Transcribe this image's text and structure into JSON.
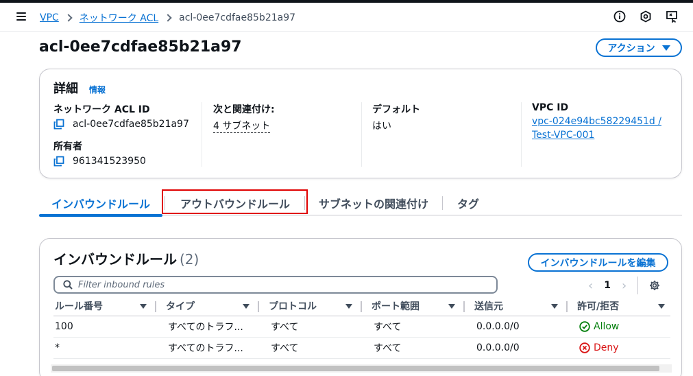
{
  "breadcrumb": {
    "root": "VPC",
    "parent": "ネットワーク ACL",
    "current": "acl-0ee7cdfae85b21a97"
  },
  "page": {
    "title": "acl-0ee7cdfae85b21a97",
    "actions_label": "アクション"
  },
  "details": {
    "heading": "詳細",
    "info": "情報",
    "acl_id_label": "ネットワーク ACL ID",
    "acl_id_value": "acl-0ee7cdfae85b21a97",
    "owner_label": "所有者",
    "owner_value": "961341523950",
    "assoc_label": "次と関連付け:",
    "assoc_value": "4 サブネット",
    "default_label": "デフォルト",
    "default_value": "はい",
    "vpc_label": "VPC ID",
    "vpc_value_line1": "vpc-024e94bc58229451d /",
    "vpc_value_line2": "Test-VPC-001"
  },
  "tabs": [
    {
      "label": "インバウンドルール",
      "active": true
    },
    {
      "label": "アウトバウンドルール",
      "active": false
    },
    {
      "label": "サブネットの関連付け",
      "active": false
    },
    {
      "label": "タグ",
      "active": false
    }
  ],
  "rules": {
    "heading": "インバウンドルール",
    "count": "(2)",
    "edit_label": "インバウンドルールを編集",
    "filter_placeholder": "Filter inbound rules",
    "page_number": "1",
    "columns": [
      "ルール番号",
      "タイプ",
      "プロトコル",
      "ポート範囲",
      "送信元",
      "許可/拒否"
    ],
    "rows": [
      {
        "number": "100",
        "type": "すべてのトラフ...",
        "protocol": "すべて",
        "ports": "すべて",
        "source": "0.0.0.0/0",
        "action": "Allow"
      },
      {
        "number": "*",
        "type": "すべてのトラフ...",
        "protocol": "すべて",
        "ports": "すべて",
        "source": "0.0.0.0/0",
        "action": "Deny"
      }
    ]
  },
  "colors": {
    "link": "#0972d3",
    "allow": "#037f0c",
    "deny": "#d91515",
    "highlight": "#e00000"
  }
}
